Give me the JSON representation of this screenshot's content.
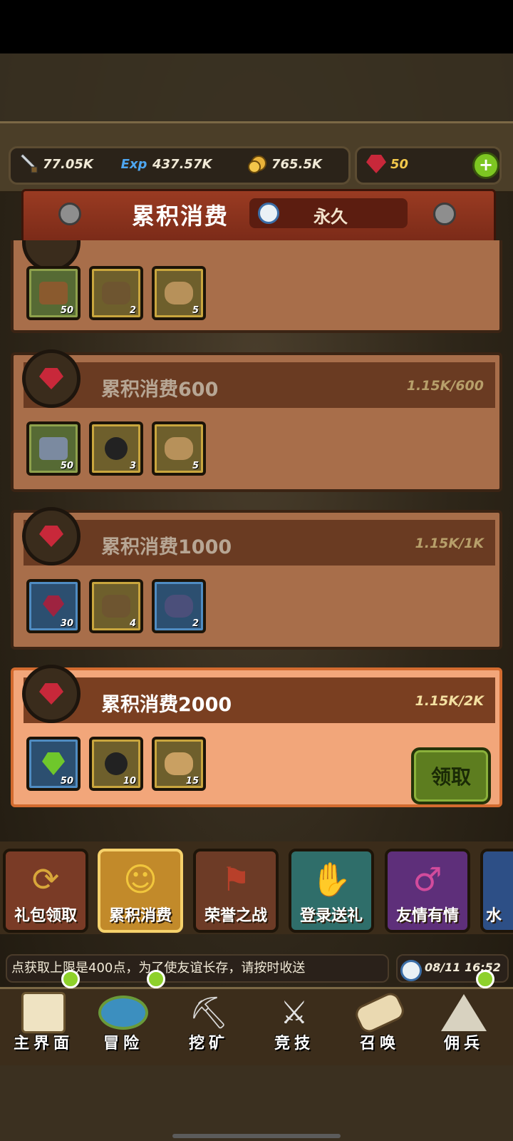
{
  "resources": {
    "attack": "77.05K",
    "exp_label": "Exp",
    "exp": "437.57K",
    "gold": "765.5K",
    "gems": "50"
  },
  "banner": {
    "title": "累积消费",
    "duration": "永久"
  },
  "cards": [
    {
      "title": "",
      "progress": "",
      "rewards": [
        {
          "icon": "wood-plank",
          "count": "50"
        },
        {
          "icon": "golem-figure",
          "count": "2"
        },
        {
          "icon": "leather-sack",
          "count": "5"
        }
      ]
    },
    {
      "title": "累积消费600",
      "progress": "1.15K/600",
      "rewards": [
        {
          "icon": "iron-ingot",
          "count": "50"
        },
        {
          "icon": "bomb",
          "count": "3"
        },
        {
          "icon": "leather-sack",
          "count": "5"
        }
      ]
    },
    {
      "title": "累积消费1000",
      "progress": "1.15K/1K",
      "rewards": [
        {
          "icon": "red-gem",
          "count": "30"
        },
        {
          "icon": "golem-figure",
          "count": "4"
        },
        {
          "icon": "magic-bag",
          "count": "2"
        }
      ]
    },
    {
      "title": "累积消费2000",
      "progress": "1.15K/2K",
      "rewards": [
        {
          "icon": "green-gem",
          "count": "50"
        },
        {
          "icon": "bomb",
          "count": "10"
        },
        {
          "icon": "leather-sack",
          "count": "15"
        }
      ],
      "claim_label": "领取"
    }
  ],
  "tabs": [
    {
      "label": "礼包领取"
    },
    {
      "label": "累积消费",
      "selected": true
    },
    {
      "label": "荣誉之战"
    },
    {
      "label": "登录送礼"
    },
    {
      "label": "友情有情"
    },
    {
      "label": "水"
    }
  ],
  "ticker": {
    "text": "点获取上限是400点，为了使友谊长存，请按时收送",
    "datetime": "08/11 16:52"
  },
  "nav": [
    {
      "label": "主界面",
      "badge": true
    },
    {
      "label": "冒险",
      "badge": true
    },
    {
      "label": "挖矿",
      "badge": false
    },
    {
      "label": "竞技",
      "badge": false
    },
    {
      "label": "召唤",
      "badge": false
    },
    {
      "label": "佣兵",
      "badge": true
    }
  ],
  "colors": {
    "accent_active_card": "#f2a67a",
    "claim_button": "#5d7d1f",
    "badge": "#8ed12b",
    "gem": "#c8283a"
  }
}
